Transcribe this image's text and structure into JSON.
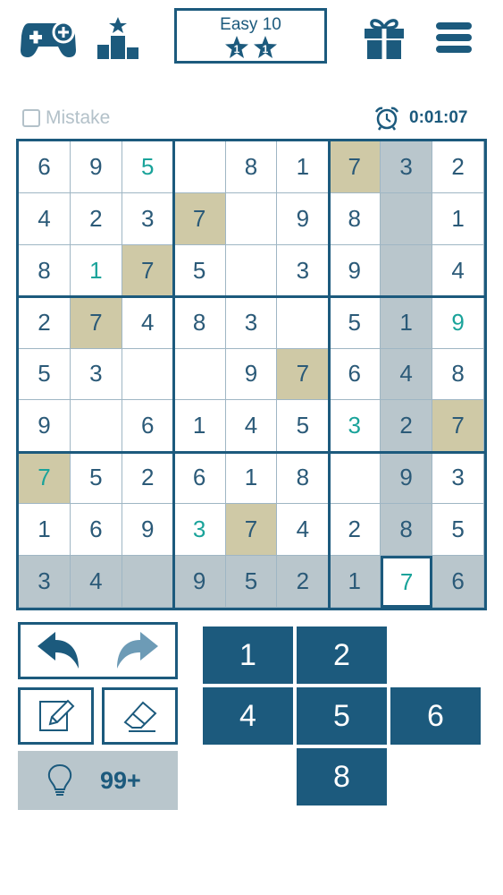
{
  "header": {
    "level": "Easy 10",
    "star_digits": [
      "1",
      "1"
    ],
    "icons": [
      "gamepad-plus-icon",
      "leaderboard-icon",
      "gift-icon",
      "menu-icon"
    ]
  },
  "status": {
    "mistake_label": "Mistake",
    "mistake_checked": false,
    "timer": "0:01:07"
  },
  "colors": {
    "primary": "#1c5a7d",
    "cell_text": "#2b5a78",
    "user_entry": "#1aa39a",
    "highlight_row_col": "#b9c6cc",
    "same_number": "#cfc9a6",
    "checkbox_gray": "#b3c1c9"
  },
  "board": {
    "rows": [
      [
        "6",
        "9",
        "5",
        "",
        "8",
        "1",
        "7",
        "3",
        "2"
      ],
      [
        "4",
        "2",
        "3",
        "7",
        "",
        "9",
        "8",
        "",
        "1"
      ],
      [
        "8",
        "1",
        "7",
        "5",
        "",
        "3",
        "9",
        "",
        "4"
      ],
      [
        "2",
        "7",
        "4",
        "8",
        "3",
        "",
        "5",
        "1",
        "9"
      ],
      [
        "5",
        "3",
        "",
        "",
        "9",
        "7",
        "6",
        "4",
        "8"
      ],
      [
        "9",
        "",
        "6",
        "1",
        "4",
        "5",
        "3",
        "2",
        "7"
      ],
      [
        "7",
        "5",
        "2",
        "6",
        "1",
        "8",
        "",
        "9",
        "3"
      ],
      [
        "1",
        "6",
        "9",
        "3",
        "7",
        "4",
        "2",
        "8",
        "5"
      ],
      [
        "3",
        "4",
        "",
        "9",
        "5",
        "2",
        "1",
        "7",
        "6"
      ]
    ],
    "user_entries": [
      [
        0,
        2
      ],
      [
        2,
        1
      ],
      [
        3,
        8
      ],
      [
        5,
        6
      ],
      [
        6,
        0
      ],
      [
        7,
        3
      ],
      [
        8,
        7
      ]
    ],
    "selected": [
      8,
      7
    ],
    "same_number_cells": [
      [
        0,
        6
      ],
      [
        1,
        3
      ],
      [
        2,
        2
      ],
      [
        3,
        1
      ],
      [
        4,
        5
      ],
      [
        5,
        8
      ],
      [
        6,
        0
      ],
      [
        7,
        4
      ]
    ]
  },
  "controls": {
    "undo_icon": "undo-arrow-icon",
    "redo_icon": "redo-arrow-icon",
    "pencil_icon": "pencil-icon",
    "eraser_icon": "eraser-icon",
    "hint_icon": "lightbulb-icon",
    "hint_count": "99+"
  },
  "numpad": [
    {
      "label": "1",
      "row": 0,
      "col": 0
    },
    {
      "label": "2",
      "row": 0,
      "col": 1
    },
    {
      "label": "4",
      "row": 1,
      "col": 0
    },
    {
      "label": "5",
      "row": 1,
      "col": 1
    },
    {
      "label": "6",
      "row": 1,
      "col": 2
    },
    {
      "label": "8",
      "row": 2,
      "col": 1
    }
  ]
}
